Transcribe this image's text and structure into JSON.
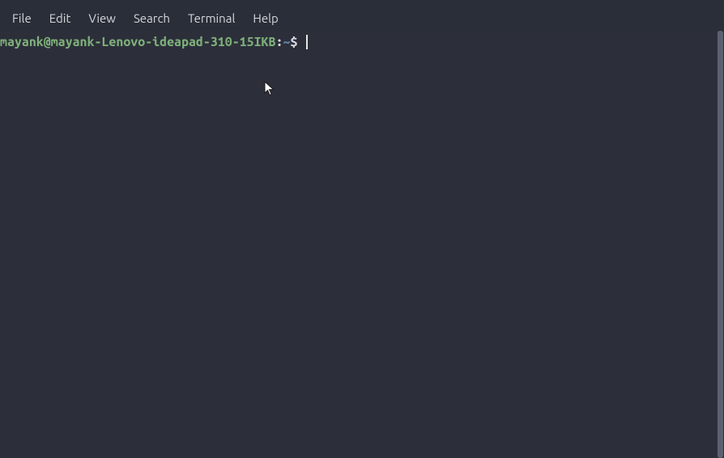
{
  "menubar": {
    "items": [
      {
        "label": "File"
      },
      {
        "label": "Edit"
      },
      {
        "label": "View"
      },
      {
        "label": "Search"
      },
      {
        "label": "Terminal"
      },
      {
        "label": "Help"
      }
    ]
  },
  "prompt": {
    "userhost": "mayank@mayank-Lenovo-ideapad-310-15IKB",
    "sep": ":",
    "path": "~",
    "dollar": "$"
  },
  "terminal": {
    "input_value": ""
  }
}
